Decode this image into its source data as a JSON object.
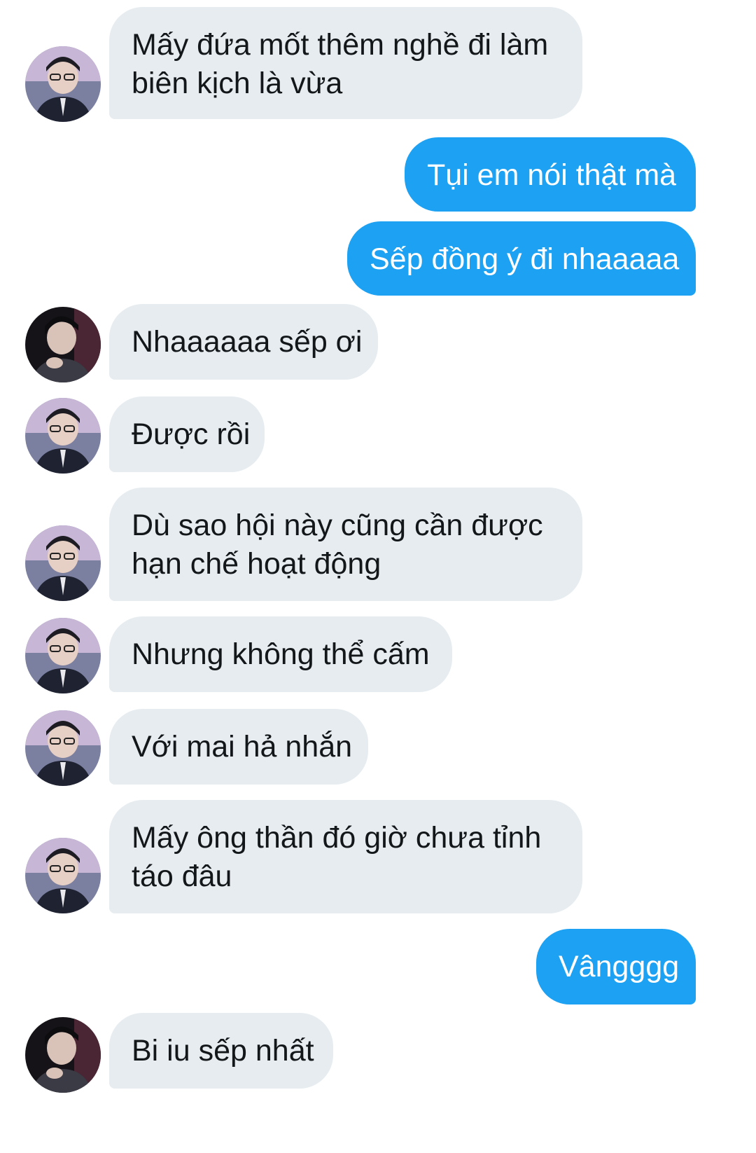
{
  "messages": [
    {
      "side": "in",
      "avatar": "avatar-glasses",
      "lines": [
        "Mấy đứa mốt thêm nghề đi làm",
        "biên kịch là vừa"
      ]
    },
    {
      "side": "out",
      "lines": [
        "Tụi em nói thật mà"
      ]
    },
    {
      "side": "out",
      "lines": [
        "Sếp đồng ý đi nhaaaaa"
      ]
    },
    {
      "side": "in",
      "avatar": "avatar-dark",
      "lines": [
        "Nhaaaaaa sếp ơi"
      ]
    },
    {
      "side": "in",
      "avatar": "avatar-glasses",
      "lines": [
        "Được rồi"
      ]
    },
    {
      "side": "in",
      "avatar": "avatar-glasses",
      "lines": [
        "Dù sao hội này cũng cần được",
        "hạn chế hoạt động"
      ]
    },
    {
      "side": "in",
      "avatar": "avatar-glasses",
      "lines": [
        "Nhưng không thể cấm"
      ]
    },
    {
      "side": "in",
      "avatar": "avatar-glasses",
      "lines": [
        "Với mai hả nhắn"
      ]
    },
    {
      "side": "in",
      "avatar": "avatar-glasses",
      "lines": [
        "Mấy ông thần đó giờ chưa tỉnh",
        "táo đâu"
      ]
    },
    {
      "side": "out",
      "lines": [
        "Vângggg"
      ]
    },
    {
      "side": "in",
      "avatar": "avatar-dark",
      "lines": [
        "Bi iu sếp nhất"
      ]
    }
  ],
  "colors": {
    "incoming_bubble": "#e6ecf0",
    "outgoing_bubble": "#1da1f2",
    "incoming_text": "#14171a",
    "outgoing_text": "#ffffff"
  }
}
